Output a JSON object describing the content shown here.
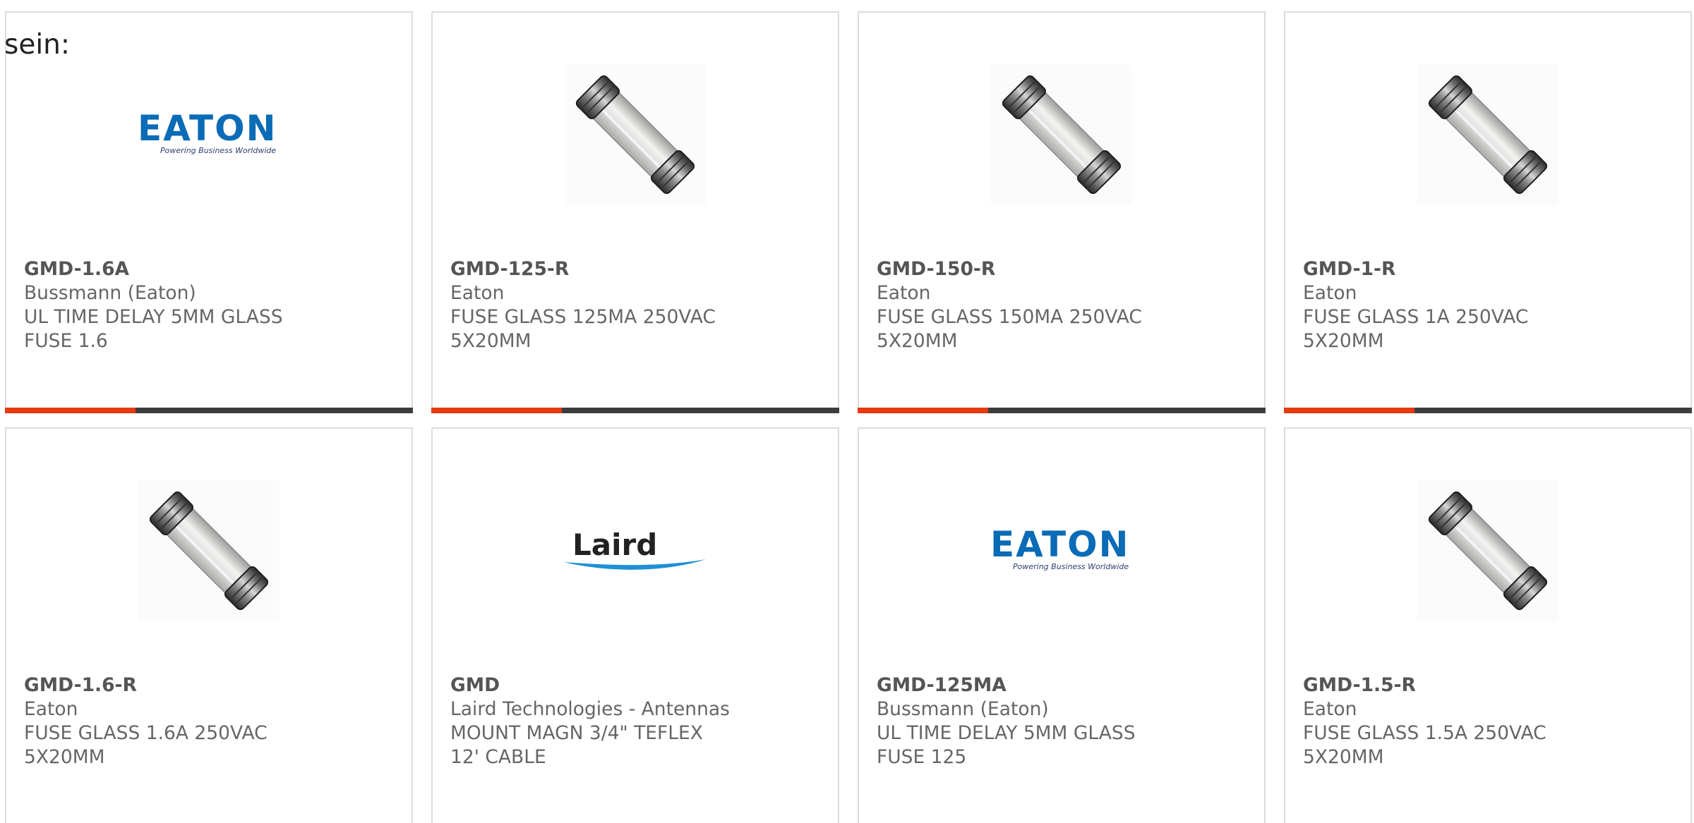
{
  "intro_text": "sein:",
  "accent_color": "#e63a12",
  "bar_color": "#3d3d3d",
  "products": [
    {
      "part_number": "GMD-1.6A",
      "manufacturer": "Bussmann (Eaton)",
      "description": "UL TIME DELAY 5MM GLASS FUSE 1.6",
      "image": "eaton-logo",
      "logo_text": "EATON",
      "logo_tagline": "Powering Business Worldwide",
      "has_bar": true
    },
    {
      "part_number": "GMD-125-R",
      "manufacturer": "Eaton",
      "description": "FUSE GLASS 125MA 250VAC 5X20MM",
      "image": "glass-fuse",
      "has_bar": true
    },
    {
      "part_number": "GMD-150-R",
      "manufacturer": "Eaton",
      "description": "FUSE GLASS 150MA 250VAC 5X20MM",
      "image": "glass-fuse",
      "has_bar": true
    },
    {
      "part_number": "GMD-1-R",
      "manufacturer": "Eaton",
      "description": "FUSE GLASS 1A 250VAC 5X20MM",
      "image": "glass-fuse",
      "has_bar": true
    },
    {
      "part_number": "GMD-1.6-R",
      "manufacturer": "Eaton",
      "description": "FUSE GLASS 1.6A 250VAC 5X20MM",
      "image": "glass-fuse",
      "has_bar": false
    },
    {
      "part_number": "GMD",
      "manufacturer": "Laird Technologies - Antennas",
      "description": "MOUNT MAGN 3/4\" TEFLEX 12' CABLE",
      "image": "laird-logo",
      "logo_text": "Laird",
      "has_bar": false
    },
    {
      "part_number": "GMD-125MA",
      "manufacturer": "Bussmann (Eaton)",
      "description": "UL TIME DELAY 5MM GLASS FUSE 125",
      "image": "eaton-logo",
      "logo_text": "EATON",
      "logo_tagline": "Powering Business Worldwide",
      "has_bar": false
    },
    {
      "part_number": "GMD-1.5-R",
      "manufacturer": "Eaton",
      "description": "FUSE GLASS 1.5A 250VAC 5X20MM",
      "image": "glass-fuse",
      "has_bar": false
    }
  ]
}
